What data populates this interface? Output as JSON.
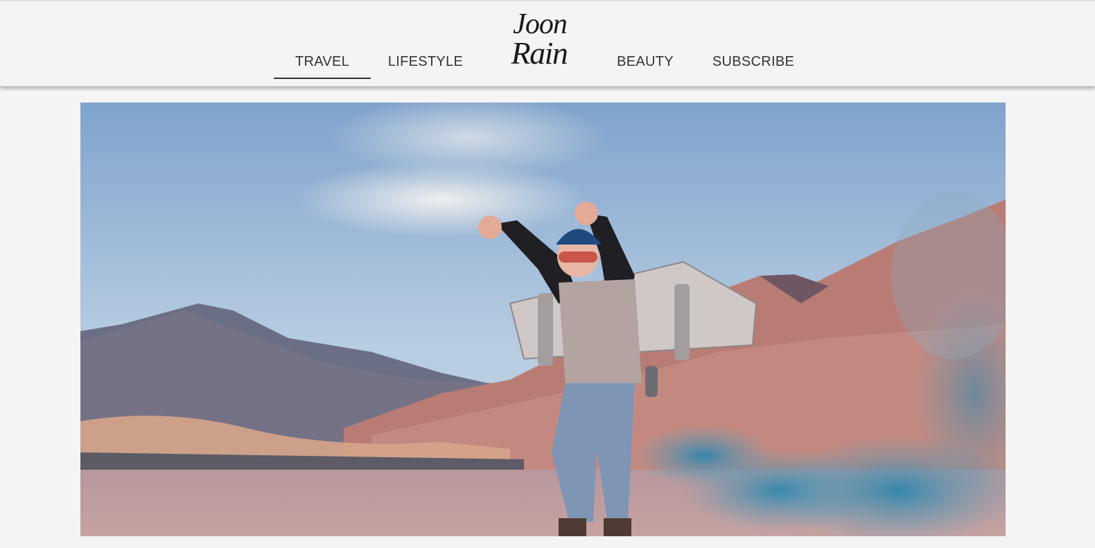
{
  "nav": {
    "items": [
      {
        "label": "TRAVEL",
        "active": true
      },
      {
        "label": "LIFESTYLE",
        "active": false
      },
      {
        "label": "BEAUTY",
        "active": false
      },
      {
        "label": "SUBSCRIBE",
        "active": false
      }
    ]
  },
  "logo": {
    "line1": "Joon",
    "line2": "Rain"
  },
  "hero": {
    "image": "child-with-cardboard-jetpack-photo"
  },
  "colors": {
    "background": "#f4f4f4",
    "nav_text": "#333333",
    "sky": "#9fb8d6",
    "mountains": "#c28a80",
    "smoke": "#3f8fb0"
  }
}
